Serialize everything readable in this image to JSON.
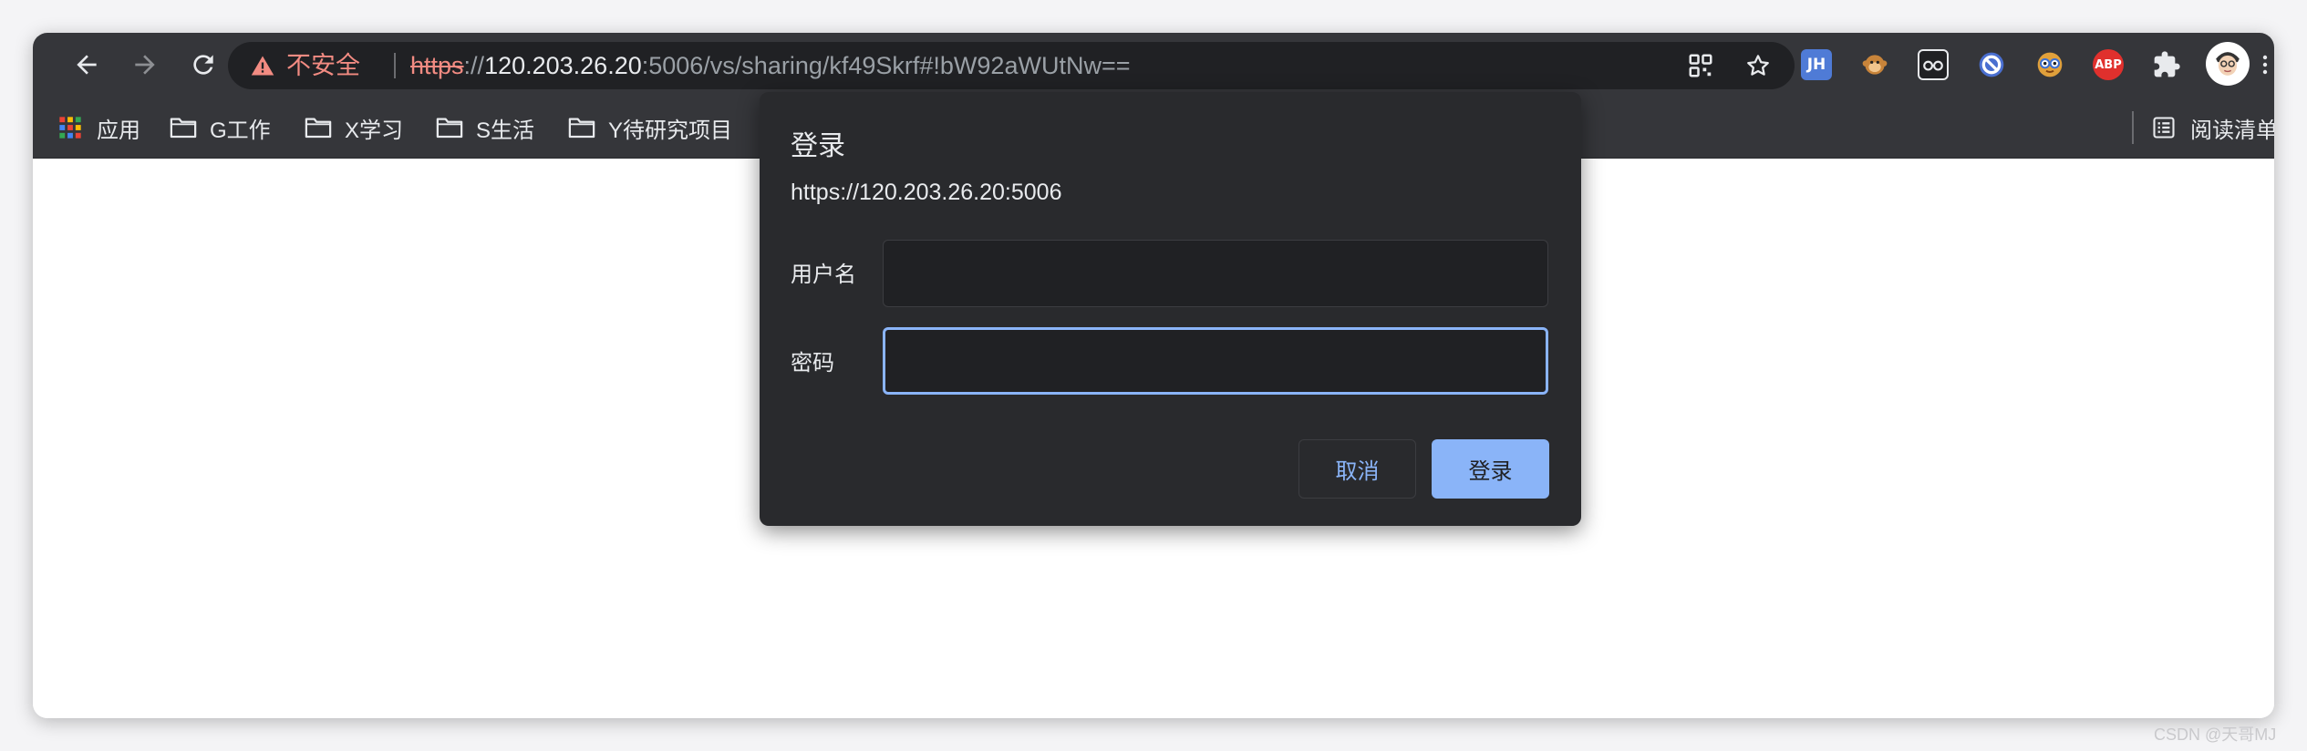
{
  "browser": {
    "omnibox": {
      "security_label": "不安全",
      "url_scheme": "https",
      "url_separator": "://",
      "url_host": "120.203.26.20",
      "url_rest": ":5006/vs/sharing/kf49Skrf#!bW92aWUtNw=="
    },
    "extensions": [
      {
        "name": "JH",
        "color": "#4f7bd6"
      },
      {
        "name": "monkey",
        "color": "#d8913a"
      },
      {
        "name": "glasses-box",
        "color": "#202124"
      },
      {
        "name": "blocked-circle",
        "color": "#4a6fd0"
      },
      {
        "name": "nerd-face",
        "color": "#e0a03b"
      },
      {
        "name": "ABP",
        "color": "#e0302d"
      }
    ]
  },
  "bookmarks": [
    {
      "label": "应用",
      "icon": "apps-grid-icon"
    },
    {
      "label": "G工作",
      "icon": "folder-icon"
    },
    {
      "label": "X学习",
      "icon": "folder-icon"
    },
    {
      "label": "S生活",
      "icon": "folder-icon"
    },
    {
      "label": "Y待研究项目",
      "icon": "folder-icon"
    }
  ],
  "reading_list": {
    "label": "阅读清单"
  },
  "dialog": {
    "title": "登录",
    "origin": "https://120.203.26.20:5006",
    "username_label": "用户名",
    "password_label": "密码",
    "cancel_label": "取消",
    "login_label": "登录"
  },
  "watermark": "CSDN @天哥MJ",
  "colors": {
    "toolbar": "#35363a",
    "omnibox": "#202124",
    "dialog": "#292a2d",
    "accent": "#8ab4f8",
    "danger": "#f28b82"
  }
}
